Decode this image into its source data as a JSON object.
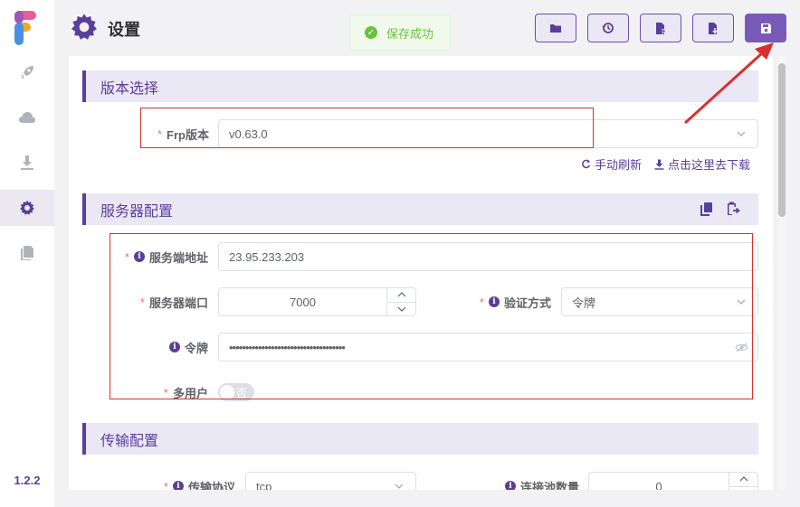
{
  "app": {
    "version": "1.2.2"
  },
  "header": {
    "title": "设置",
    "toast": "保存成功"
  },
  "sidebar": {
    "items": [
      {
        "icon": "rocket-icon",
        "active": false
      },
      {
        "icon": "cloud-icon",
        "active": false
      },
      {
        "icon": "download-icon",
        "active": false
      },
      {
        "icon": "gear-icon",
        "active": true
      },
      {
        "icon": "file-icon",
        "active": false
      }
    ]
  },
  "toolbar": {
    "buttons": [
      "folder-icon",
      "history-icon",
      "file-export-icon",
      "file-import-icon",
      "save-icon"
    ]
  },
  "sections": {
    "version": {
      "title": "版本选择",
      "frp_label": "Frp版本",
      "frp_value": "v0.63.0",
      "refresh_link": "手动刷新",
      "download_link": "点击这里去下载"
    },
    "server": {
      "title": "服务器配置",
      "addr_label": "服务端地址",
      "addr_value": "23.95.233.203",
      "port_label": "服务器端口",
      "port_value": "7000",
      "auth_label": "验证方式",
      "auth_value": "令牌",
      "token_label": "令牌",
      "token_value": "••••••••••••••••••••••••••••••••••••",
      "multiuser_label": "多用户",
      "multiuser_toggle": "否"
    },
    "transport": {
      "title": "传输配置",
      "protocol_label": "传输协议",
      "protocol_value": "tcp",
      "pool_label": "连接池数量",
      "pool_value": "0"
    }
  },
  "colors": {
    "accent": "#5a3e9b",
    "success": "#67c23a",
    "annotation": "#d9302e"
  }
}
